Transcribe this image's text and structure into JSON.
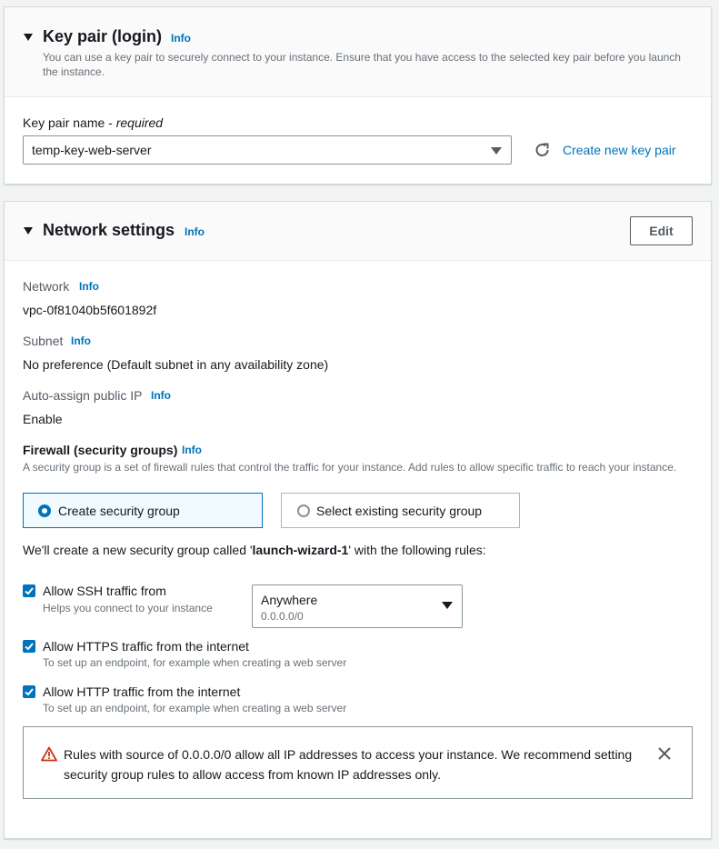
{
  "key_pair": {
    "title": "Key pair (login)",
    "info": "Info",
    "description": "You can use a key pair to securely connect to your instance. Ensure that you have access to the selected key pair before you launch the instance.",
    "field_label": "Key pair name - ",
    "field_required": "required",
    "selected_value": "temp-key-web-server",
    "refresh_icon": "refresh-icon",
    "create_link": "Create new key pair"
  },
  "network": {
    "title": "Network settings",
    "info": "Info",
    "edit_label": "Edit",
    "network_label": "Network",
    "network_info": "Info",
    "network_value": "vpc-0f81040b5f601892f",
    "subnet_label": "Subnet",
    "subnet_info": "Info",
    "subnet_value": "No preference (Default subnet in any availability zone)",
    "public_ip_label": "Auto-assign public IP",
    "public_ip_info": "Info",
    "public_ip_value": "Enable",
    "firewall_label": "Firewall (security groups)",
    "firewall_info": "Info",
    "firewall_desc": "A security group is a set of firewall rules that control the traffic for your instance. Add rules to allow specific traffic to reach your instance.",
    "option_create": "Create security group",
    "option_existing": "Select existing security group",
    "sg_intro_before": "We'll create a new security group called '",
    "sg_name": "launch-wizard-1",
    "sg_intro_after": "' with the following rules:",
    "rules": [
      {
        "label": "Allow SSH traffic from",
        "help": "Helps you connect to your instance",
        "checked": true
      },
      {
        "label": "Allow HTTPS traffic from the internet",
        "help": "To set up an endpoint, for example when creating a web server",
        "checked": true
      },
      {
        "label": "Allow HTTP traffic from the internet",
        "help": "To set up an endpoint, for example when creating a web server",
        "checked": true
      }
    ],
    "ssh_source_value": "Anywhere",
    "ssh_source_cidr": "0.0.0.0/0",
    "warning_text_line1": "Rules with source of 0.0.0.0/0 allow all IP addresses to access your instance. We recommend setting",
    "warning_text_line2": "security group rules to allow access from known IP addresses only.",
    "warning_icon": "warning-icon",
    "close_icon": "close-icon"
  },
  "colors": {
    "accent": "#0073bb",
    "warning": "#d13212",
    "text": "#16191f"
  }
}
